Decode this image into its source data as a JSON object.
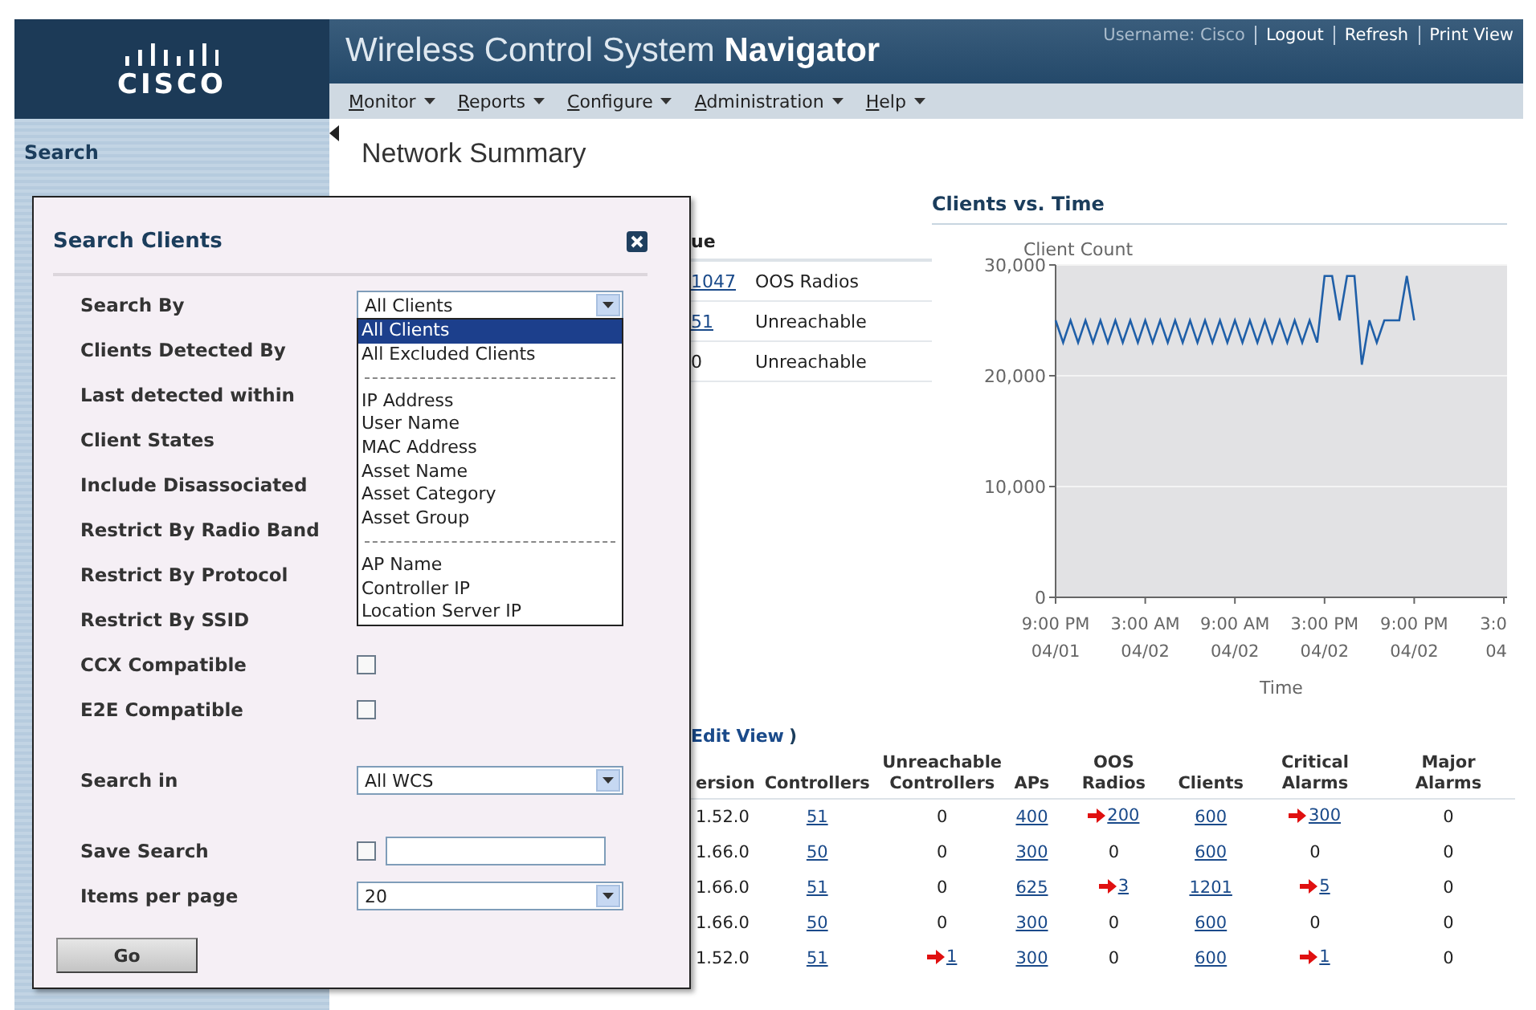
{
  "header": {
    "logo": "CISCO",
    "title": "Wireless Control System **Navigator**",
    "links": [
      {
        "text": "Username: Cisco",
        "kind": "text"
      },
      {
        "text": "Logout",
        "kind": "link"
      },
      {
        "text": "Refresh",
        "kind": "link"
      },
      {
        "text": "Print View",
        "kind": "link"
      }
    ]
  },
  "menu": [
    {
      "label": "Monitor"
    },
    {
      "label": "Reports"
    },
    {
      "label": "Configure"
    },
    {
      "label": "Administration"
    },
    {
      "label": "Help"
    }
  ],
  "sidebar": {
    "title": "Search"
  },
  "page_title": "Network Summary",
  "summary_fragment": {
    "header": "ue",
    "rows": [
      {
        "value": "1047",
        "link": true,
        "label": "OOS Radios"
      },
      {
        "value": "51",
        "link": true,
        "label": "Unreachable"
      },
      {
        "value": "0",
        "link": false,
        "label": "Unreachable"
      }
    ]
  },
  "chart": {
    "title": "Clients vs. Time",
    "chart_data": {
      "type": "line",
      "xlabel": "Time",
      "ylabel": "Client Count",
      "categories": [
        "9:00 PM\n04/01",
        null,
        null,
        null,
        null,
        null,
        null,
        null,
        null,
        null,
        null,
        null,
        "3:00 AM\n04/02",
        null,
        null,
        null,
        null,
        null,
        null,
        null,
        null,
        null,
        null,
        null,
        "9:00 AM\n04/02",
        null,
        null,
        null,
        null,
        null,
        null,
        null,
        null,
        null,
        null,
        null,
        "3:00 PM\n04/02",
        null,
        null,
        null,
        null,
        null,
        null,
        null,
        null,
        null,
        null,
        null,
        "9:00 PM\n04/02",
        null,
        null,
        null,
        null,
        null,
        null,
        null,
        null,
        null,
        null,
        null,
        "3:0\n04"
      ],
      "series": [
        {
          "color": "#1f5fa8",
          "values": [
            25000,
            23000,
            25000,
            23000,
            25000,
            23000,
            25000,
            23000,
            25000,
            23000,
            25000,
            23000,
            25000,
            23000,
            25000,
            23000,
            25000,
            23000,
            25000,
            23000,
            25000,
            23000,
            25000,
            23000,
            25000,
            23000,
            25000,
            23000,
            25000,
            23000,
            25000,
            23000,
            25000,
            23000,
            25000,
            23000,
            29000,
            29000,
            25000,
            29000,
            29000,
            21000,
            25000,
            23000,
            25000,
            25000,
            25000,
            29000,
            25000,
            null,
            null,
            null,
            null,
            null,
            null,
            null,
            null,
            null,
            null,
            null,
            null
          ]
        }
      ],
      "ylim": [
        0,
        30000
      ],
      "yticks": [
        {
          "value": 0,
          "label": "0"
        },
        {
          "value": 10000,
          "label": "10,000"
        },
        {
          "value": 20000,
          "label": "20,000"
        },
        {
          "value": 30000,
          "label": "30,000"
        }
      ]
    }
  },
  "controllers": {
    "edit_link": "Edit View",
    "edit_suffix": ")",
    "columns": [
      "ersion",
      "Controllers",
      "Unreachable Controllers",
      "APs",
      "OOS Radios",
      "Clients",
      "Critical Alarms",
      "Major Alarms"
    ],
    "rows": [
      [
        {
          "text": "1.52.0",
          "link": false,
          "alert": false
        },
        {
          "text": "51",
          "link": true,
          "alert": false
        },
        {
          "text": "0",
          "link": false,
          "alert": false
        },
        {
          "text": "400",
          "link": true,
          "alert": false
        },
        {
          "text": "200",
          "link": true,
          "alert": true
        },
        {
          "text": "600",
          "link": true,
          "alert": false
        },
        {
          "text": "300",
          "link": true,
          "alert": true
        },
        {
          "text": "0",
          "link": false,
          "alert": false
        }
      ],
      [
        {
          "text": "1.66.0",
          "link": false,
          "alert": false
        },
        {
          "text": "50",
          "link": true,
          "alert": false
        },
        {
          "text": "0",
          "link": false,
          "alert": false
        },
        {
          "text": "300",
          "link": true,
          "alert": false
        },
        {
          "text": "0",
          "link": false,
          "alert": false
        },
        {
          "text": "600",
          "link": true,
          "alert": false
        },
        {
          "text": "0",
          "link": false,
          "alert": false
        },
        {
          "text": "0",
          "link": false,
          "alert": false
        }
      ],
      [
        {
          "text": "1.66.0",
          "link": false,
          "alert": false
        },
        {
          "text": "51",
          "link": true,
          "alert": false
        },
        {
          "text": "0",
          "link": false,
          "alert": false
        },
        {
          "text": "625",
          "link": true,
          "alert": false
        },
        {
          "text": "3",
          "link": true,
          "alert": true
        },
        {
          "text": "1201",
          "link": true,
          "alert": false
        },
        {
          "text": "5",
          "link": true,
          "alert": true
        },
        {
          "text": "0",
          "link": false,
          "alert": false
        }
      ],
      [
        {
          "text": "1.66.0",
          "link": false,
          "alert": false
        },
        {
          "text": "50",
          "link": true,
          "alert": false
        },
        {
          "text": "0",
          "link": false,
          "alert": false
        },
        {
          "text": "300",
          "link": true,
          "alert": false
        },
        {
          "text": "0",
          "link": false,
          "alert": false
        },
        {
          "text": "600",
          "link": true,
          "alert": false
        },
        {
          "text": "0",
          "link": false,
          "alert": false
        },
        {
          "text": "0",
          "link": false,
          "alert": false
        }
      ],
      [
        {
          "text": "1.52.0",
          "link": false,
          "alert": false
        },
        {
          "text": "51",
          "link": true,
          "alert": false
        },
        {
          "text": "1",
          "link": true,
          "alert": true
        },
        {
          "text": "300",
          "link": true,
          "alert": false
        },
        {
          "text": "0",
          "link": false,
          "alert": false
        },
        {
          "text": "600",
          "link": true,
          "alert": false
        },
        {
          "text": "1",
          "link": true,
          "alert": true
        },
        {
          "text": "0",
          "link": false,
          "alert": false
        }
      ]
    ]
  },
  "search_dialog": {
    "title": "Search Clients",
    "groups": [
      [
        {
          "label": "Search By",
          "kind": "select",
          "value": "All Clients",
          "open": true,
          "options": [
            {
              "kind": "option",
              "text": "All Clients",
              "selected": true
            },
            {
              "kind": "option",
              "text": "All Excluded Clients",
              "selected": false
            },
            {
              "kind": "separator"
            },
            {
              "kind": "option",
              "text": "IP Address",
              "selected": false
            },
            {
              "kind": "option",
              "text": "User Name",
              "selected": false
            },
            {
              "kind": "option",
              "text": "MAC Address",
              "selected": false
            },
            {
              "kind": "option",
              "text": "Asset Name",
              "selected": false
            },
            {
              "kind": "option",
              "text": "Asset Category",
              "selected": false
            },
            {
              "kind": "option",
              "text": "Asset Group",
              "selected": false
            },
            {
              "kind": "separator"
            },
            {
              "kind": "option",
              "text": "AP Name",
              "selected": false
            },
            {
              "kind": "option",
              "text": "Controller IP",
              "selected": false
            },
            {
              "kind": "option",
              "text": "Location Server IP",
              "selected": false
            }
          ]
        },
        {
          "label": "Clients Detected By",
          "kind": "label"
        },
        {
          "label": "Last detected within",
          "kind": "label"
        },
        {
          "label": "Client States",
          "kind": "label"
        },
        {
          "label": "Include Disassociated",
          "kind": "label"
        },
        {
          "label": "Restrict By Radio Band",
          "kind": "label"
        },
        {
          "label": "Restrict By Protocol",
          "kind": "label"
        },
        {
          "label": "Restrict By SSID",
          "kind": "label"
        },
        {
          "label": "CCX Compatible",
          "kind": "checkbox",
          "checked": false
        },
        {
          "label": "E2E Compatible",
          "kind": "checkbox",
          "checked": false
        }
      ],
      [
        {
          "label": "Search in",
          "kind": "select",
          "value": "All WCS",
          "open": false
        }
      ],
      [
        {
          "label": "Save Search",
          "kind": "checkbox_text",
          "checked": false
        },
        {
          "label": "Items per page",
          "kind": "select",
          "value": "20",
          "open": false
        }
      ]
    ],
    "go": "Go"
  }
}
